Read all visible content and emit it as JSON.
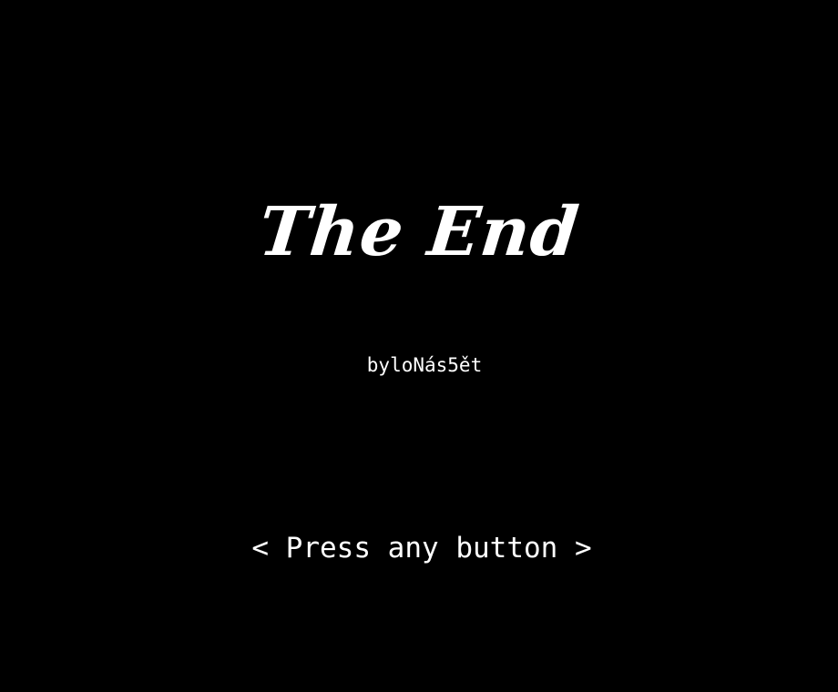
{
  "screen": {
    "title": "The End",
    "credit": "byloNás5ět",
    "prompt": "< Press any button >"
  },
  "colors": {
    "background": "#000000",
    "text": "#ffffff"
  }
}
